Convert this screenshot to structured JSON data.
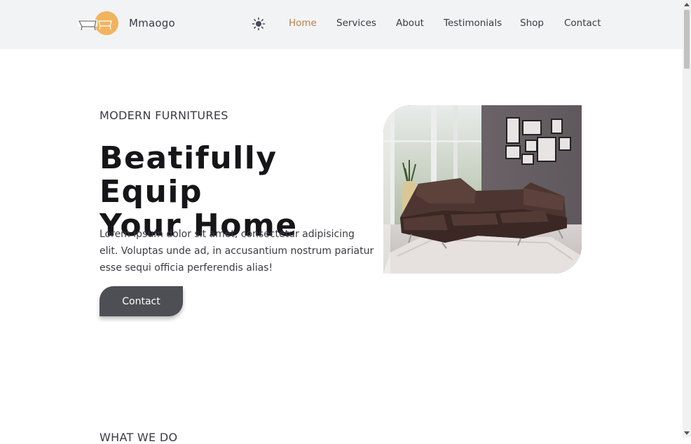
{
  "header": {
    "brand": "Mmaogo",
    "logo_icon": "sofa-logo-icon",
    "theme_icon": "sun-icon",
    "nav": [
      {
        "label": "Home",
        "active": true
      },
      {
        "label": "Services",
        "active": false
      },
      {
        "label": "About",
        "active": false
      },
      {
        "label": "Testimonials",
        "active": false
      },
      {
        "label": "Shop",
        "active": false
      },
      {
        "label": "Contact",
        "active": false
      }
    ]
  },
  "hero": {
    "eyebrow": "MODERN FURNITURES",
    "title_line1": "Beatifully Equip",
    "title_line2": "Your Home",
    "text": "Lorem ipsum dolor sit amet, consectetur adipisicing elit. Voluptas unde ad, in accusantium nostrum pariatur esse sequi officia perferendis alias!",
    "cta_label": "Contact",
    "image_icon": "living-room-sofa-image"
  },
  "next_section": {
    "eyebrow": "WHAT WE DO"
  },
  "colors": {
    "accent": "#b8804a",
    "logo_circle": "#f0b460",
    "header_bg": "#f2f3f4",
    "button_bg": "#4e4e55",
    "heading": "#16161a"
  }
}
